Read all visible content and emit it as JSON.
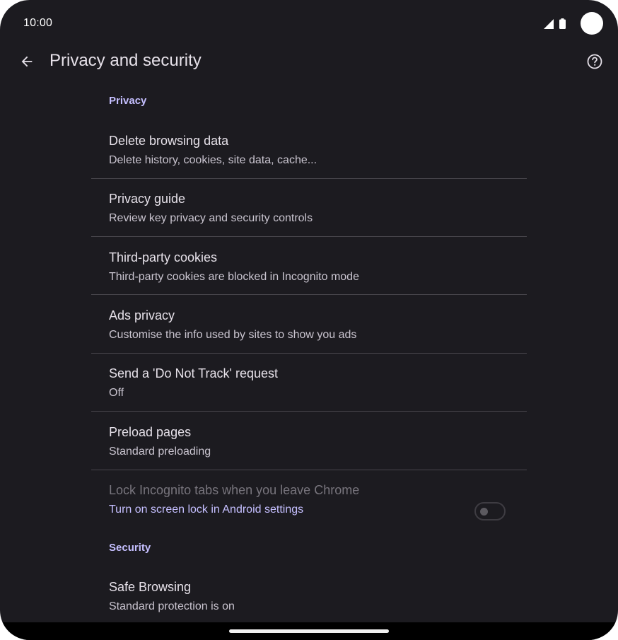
{
  "status_bar": {
    "time": "10:00"
  },
  "app_bar": {
    "title": "Privacy and security",
    "back_icon": "arrow-back-icon",
    "help_icon": "help-circle-icon"
  },
  "sections": {
    "privacy": {
      "header": "Privacy",
      "items": [
        {
          "title": "Delete browsing data",
          "summary": "Delete history, cookies, site data, cache..."
        },
        {
          "title": "Privacy guide",
          "summary": "Review key privacy and security controls"
        },
        {
          "title": "Third-party cookies",
          "summary": "Third-party cookies are blocked in Incognito mode"
        },
        {
          "title": "Ads privacy",
          "summary": "Customise the info used by sites to show you ads"
        },
        {
          "title": "Send a 'Do Not Track' request",
          "summary": "Off"
        },
        {
          "title": "Preload pages",
          "summary": "Standard preloading"
        },
        {
          "title": "Lock Incognito tabs when you leave Chrome",
          "summary": "Turn on screen lock in Android settings",
          "toggle_on": false,
          "enabled": false
        }
      ]
    },
    "security": {
      "header": "Security",
      "items": [
        {
          "title": "Safe Browsing",
          "summary": "Standard protection is on"
        }
      ]
    }
  },
  "colors": {
    "background": "#1c1b20",
    "accent": "#c5bfff",
    "text_primary": "#e6e1e9",
    "text_secondary": "#c9c4cf",
    "divider": "#48464c"
  }
}
